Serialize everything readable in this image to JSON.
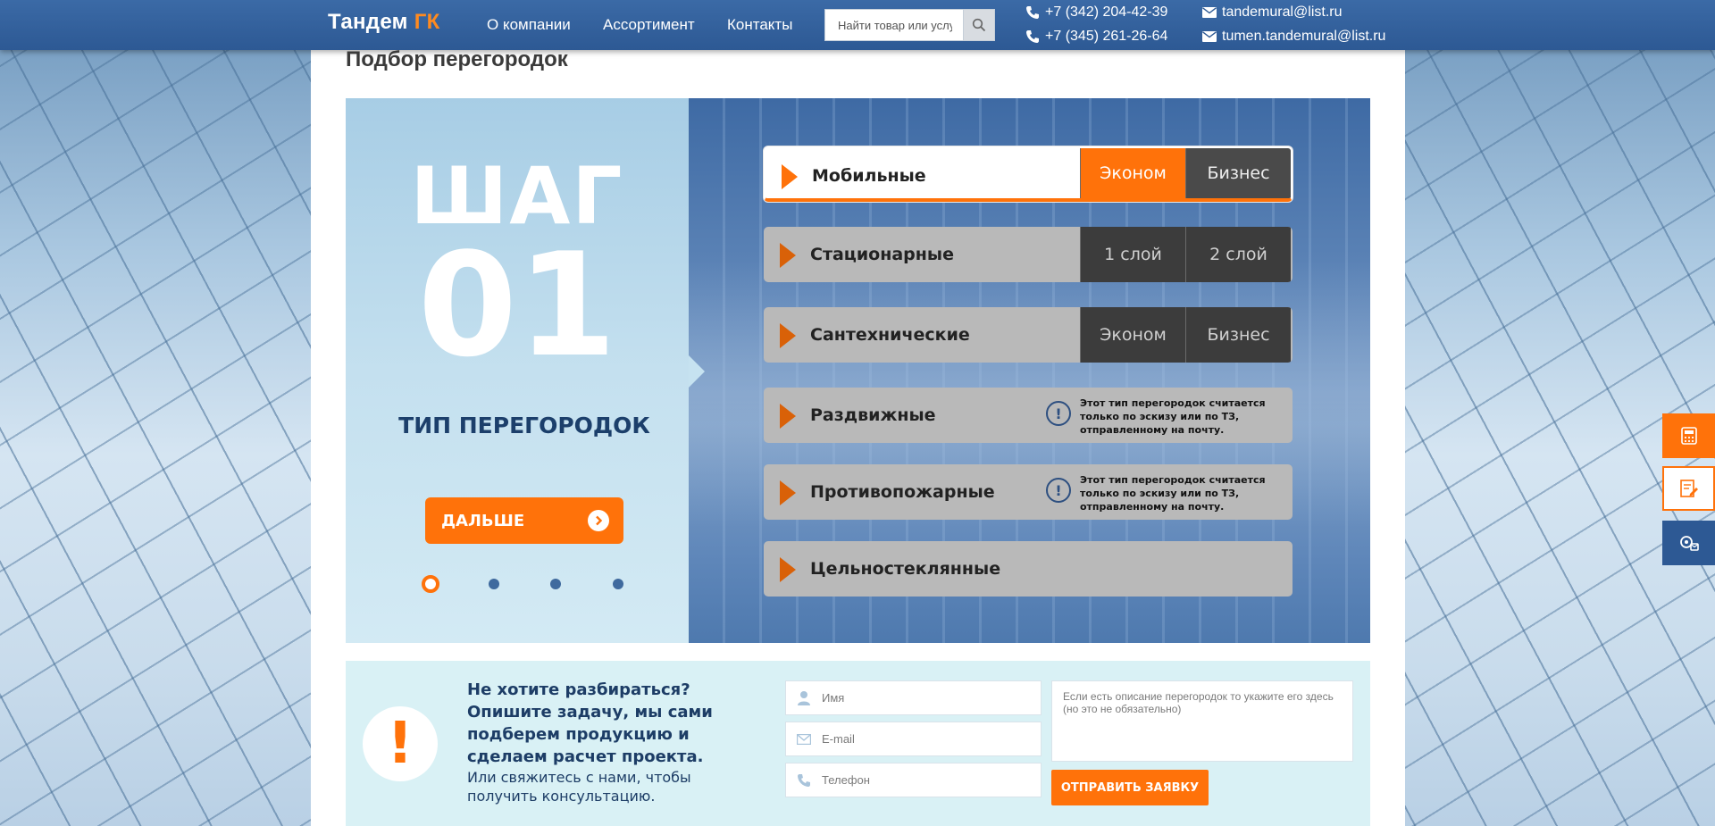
{
  "header": {
    "logo_main": "Тандем ",
    "logo_accent": "ГК",
    "nav": [
      "О компании",
      "Ассортимент",
      "Контакты"
    ],
    "search_placeholder": "Найти товар или услугу",
    "phones": [
      "+7 (342) 204-42-39",
      "+7 (345) 261-26-64"
    ],
    "emails": [
      "tandemural@list.ru",
      "tumen.tandemural@list.ru"
    ]
  },
  "page": {
    "title": "Подбор перегородок"
  },
  "wizard": {
    "step_word": "ШАГ",
    "step_number": "01",
    "step_label": "ТИП ПЕРЕГОРОДОК",
    "next_label": "ДАЛЬШЕ",
    "steps_total": 4,
    "step_active": 1,
    "options": [
      {
        "name": "Мобильные",
        "buttons": [
          "Эконом",
          "Бизнес"
        ]
      },
      {
        "name": "Стационарные",
        "buttons": [
          "1 слой",
          "2 слой"
        ]
      },
      {
        "name": "Сантехнические",
        "buttons": [
          "Эконом",
          "Бизнес"
        ]
      },
      {
        "name": "Раздвижные",
        "note": "Этот тип перегородок считается только по эскизу или по ТЗ, отправленному на почту."
      },
      {
        "name": "Противопожарные",
        "note": "Этот тип перегородок считается только по эскизу или по ТЗ, отправленному на почту."
      },
      {
        "name": "Цельностеклянные"
      }
    ]
  },
  "form": {
    "lead": "Не хотите разбираться? Опишите задачу, мы сами подберем продукцию и сделаем расчет проекта.",
    "sub": "Или свяжитесь с нами, чтобы получить консультацию.",
    "name_placeholder": "Имя",
    "email_placeholder": "E-mail",
    "phone_placeholder": "Телефон",
    "textarea_placeholder": "Если есть описание перегородок то укажите его здесь (но это не обязательно)",
    "submit_label": "ОТПРАВИТЬ ЗАЯВКУ"
  },
  "colors": {
    "accent": "#ff720a",
    "header": "#2d5994",
    "dark_text": "#1d3d66"
  }
}
